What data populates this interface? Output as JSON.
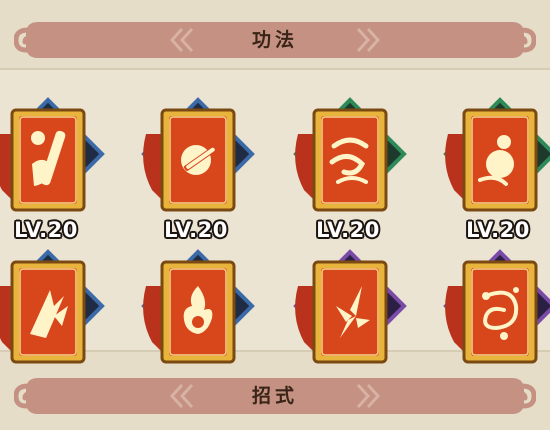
{
  "sections": {
    "top_title": "功法",
    "bottom_title": "招式"
  },
  "skills": [
    {
      "level": "LV.20",
      "icon": "scroll-brush-icon",
      "frame": "blue"
    },
    {
      "level": "LV.20",
      "icon": "sword-orb-icon",
      "frame": "blue"
    },
    {
      "level": "LV.20",
      "icon": "wind-swirl-icon",
      "frame": "green"
    },
    {
      "level": "LV.20",
      "icon": "gourd-icon",
      "frame": "green"
    },
    {
      "level": "",
      "icon": "broken-blade-icon",
      "frame": "blue"
    },
    {
      "level": "",
      "icon": "flame-sun-icon",
      "frame": "blue"
    },
    {
      "level": "",
      "icon": "dagger-blades-icon",
      "frame": "purple"
    },
    {
      "level": "",
      "icon": "chain-whip-icon",
      "frame": "purple"
    }
  ],
  "colors": {
    "background": "#ece4d2",
    "banner": "#c49182",
    "card_red": "#d8461c",
    "card_gold": "#e9b43c",
    "frame_blue": "#3b6aa8",
    "frame_green": "#2f8a5a",
    "frame_purple": "#7a4aa8"
  }
}
